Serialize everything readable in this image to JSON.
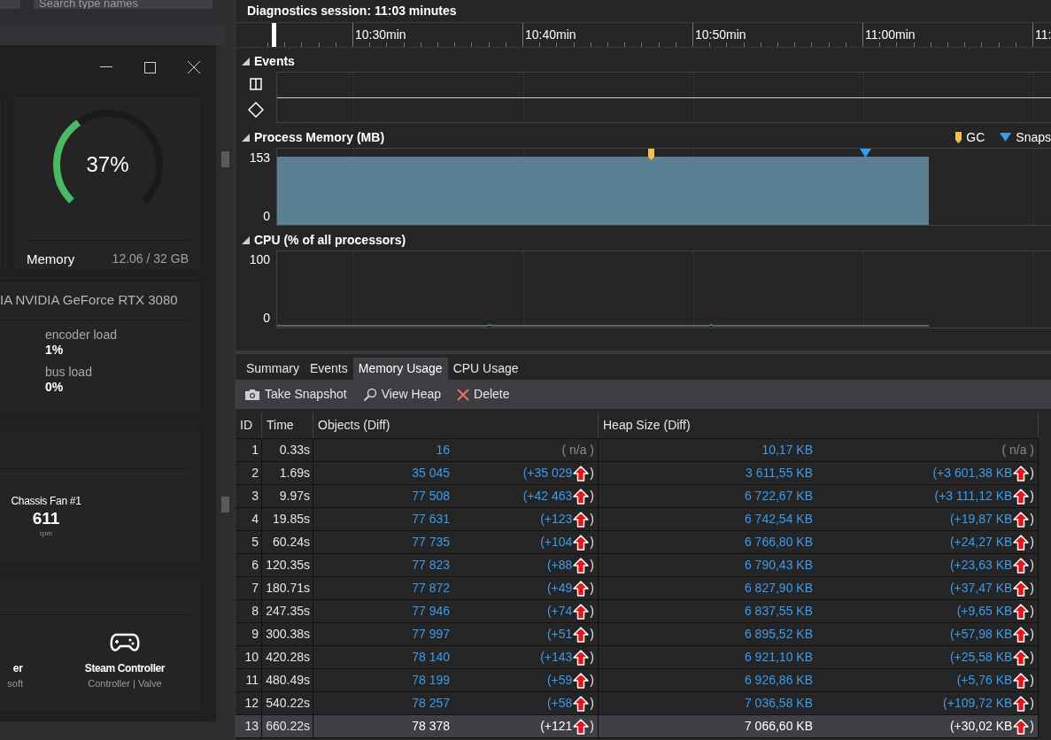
{
  "left_panel": {
    "search": {
      "placeholder": "Search type names"
    }
  },
  "widget_window": {
    "memory": {
      "level": 0.37,
      "percent": "37%",
      "label": "Memory",
      "value": "12.06 / 32 GB"
    },
    "gpu": {
      "name": "IA NVIDIA GeForce RTX 3080",
      "stats": [
        {
          "label": "encoder load",
          "value": "1%"
        },
        {
          "label": "bus load",
          "value": "0%"
        }
      ]
    },
    "fans": [
      {
        "name": "Chassis Fan #1",
        "value": "611",
        "unit": "rpm"
      }
    ],
    "devices": [
      {
        "kind": "partial",
        "name": "er",
        "vendor": "soft"
      },
      {
        "kind": "gamepad",
        "name": "Steam Controller",
        "vendor": "Controller | Valve"
      }
    ]
  },
  "session": {
    "title": "Diagnostics session: 11:03 minutes",
    "timeline_ticks": [
      "10:30min",
      "10:40min",
      "10:50min",
      "11:00min",
      "11:"
    ]
  },
  "sections": [
    {
      "kind": "events",
      "title": "Events",
      "expanded": true
    },
    {
      "kind": "memory",
      "title": "Process Memory (MB)",
      "expanded": true,
      "axis_labels": [
        "153",
        "0"
      ],
      "legend": [
        {
          "label": "GC",
          "color": "#f2c14e"
        },
        {
          "label": "Snaps",
          "color": "#3b9be6"
        }
      ]
    },
    {
      "kind": "cpu",
      "title": "CPU (% of all processors)",
      "expanded": true,
      "axis_labels": [
        "100",
        "0"
      ]
    }
  ],
  "tabs": [
    {
      "label": "Summary",
      "selected": false
    },
    {
      "label": "Events",
      "selected": false
    },
    {
      "label": "Memory Usage",
      "selected": true
    },
    {
      "label": "CPU Usage",
      "selected": false
    }
  ],
  "toolbar": [
    {
      "kind": "camera",
      "label": "Take Snapshot"
    },
    {
      "kind": "search",
      "label": "View Heap"
    },
    {
      "kind": "delete",
      "label": "Delete"
    }
  ],
  "table": {
    "columns": [
      "ID",
      "Time",
      "Objects (Diff)",
      "Heap Size (Diff)"
    ],
    "rows": [
      {
        "id": "1",
        "time": "0.33s",
        "objects": "16",
        "objects_diff": "( n/a )",
        "heap": "10,17 KB",
        "heap_diff": "( n/a )",
        "increase": false,
        "selected": false
      },
      {
        "id": "2",
        "time": "1.69s",
        "objects": "35 045",
        "objects_diff": "(+35 029",
        "objects_diff_end": ")",
        "heap": "3 611,55 KB",
        "heap_diff": "(+3 601,38 KB",
        "heap_diff_end": ")",
        "increase": true,
        "selected": false
      },
      {
        "id": "3",
        "time": "9.97s",
        "objects": "77 508",
        "objects_diff": "(+42 463",
        "objects_diff_end": ")",
        "heap": "6 722,67 KB",
        "heap_diff": "(+3 111,12 KB",
        "heap_diff_end": ")",
        "increase": true,
        "selected": false
      },
      {
        "id": "4",
        "time": "19.85s",
        "objects": "77 631",
        "objects_diff": "(+123",
        "objects_diff_end": ")",
        "heap": "6 742,54 KB",
        "heap_diff": "(+19,87 KB",
        "heap_diff_end": ")",
        "increase": true,
        "selected": false
      },
      {
        "id": "5",
        "time": "60.24s",
        "objects": "77 735",
        "objects_diff": "(+104",
        "objects_diff_end": ")",
        "heap": "6 766,80 KB",
        "heap_diff": "(+24,27 KB",
        "heap_diff_end": ")",
        "increase": true,
        "selected": false
      },
      {
        "id": "6",
        "time": "120.35s",
        "objects": "77 823",
        "objects_diff": "(+88",
        "objects_diff_end": ")",
        "heap": "6 790,43 KB",
        "heap_diff": "(+23,63 KB",
        "heap_diff_end": ")",
        "increase": true,
        "selected": false
      },
      {
        "id": "7",
        "time": "180.71s",
        "objects": "77 872",
        "objects_diff": "(+49",
        "objects_diff_end": ")",
        "heap": "6 827,90 KB",
        "heap_diff": "(+37,47 KB",
        "heap_diff_end": ")",
        "increase": true,
        "selected": false
      },
      {
        "id": "8",
        "time": "247.35s",
        "objects": "77 946",
        "objects_diff": "(+74",
        "objects_diff_end": ")",
        "heap": "6 837,55 KB",
        "heap_diff": "(+9,65 KB",
        "heap_diff_end": ")",
        "increase": true,
        "selected": false
      },
      {
        "id": "9",
        "time": "300.38s",
        "objects": "77 997",
        "objects_diff": "(+51",
        "objects_diff_end": ")",
        "heap": "6 895,52 KB",
        "heap_diff": "(+57,98 KB",
        "heap_diff_end": ")",
        "increase": true,
        "selected": false
      },
      {
        "id": "10",
        "time": "420.28s",
        "objects": "78 140",
        "objects_diff": "(+143",
        "objects_diff_end": ")",
        "heap": "6 921,10 KB",
        "heap_diff": "(+25,58 KB",
        "heap_diff_end": ")",
        "increase": true,
        "selected": false
      },
      {
        "id": "11",
        "time": "480.49s",
        "objects": "78 199",
        "objects_diff": "(+59",
        "objects_diff_end": ")",
        "heap": "6 926,86 KB",
        "heap_diff": "(+5,76 KB",
        "heap_diff_end": ")",
        "increase": true,
        "selected": false
      },
      {
        "id": "12",
        "time": "540.22s",
        "objects": "78 257",
        "objects_diff": "(+58",
        "objects_diff_end": ")",
        "heap": "7 036,58 KB",
        "heap_diff": "(+109,72 KB",
        "heap_diff_end": ")",
        "increase": true,
        "selected": false
      },
      {
        "id": "13",
        "time": "660.22s",
        "objects": "78 378",
        "objects_diff": "(+121",
        "objects_diff_end": ")",
        "heap": "7 066,60 KB",
        "heap_diff": "(+30,02 KB",
        "heap_diff_end": ")",
        "increase": true,
        "selected": true
      }
    ]
  }
}
